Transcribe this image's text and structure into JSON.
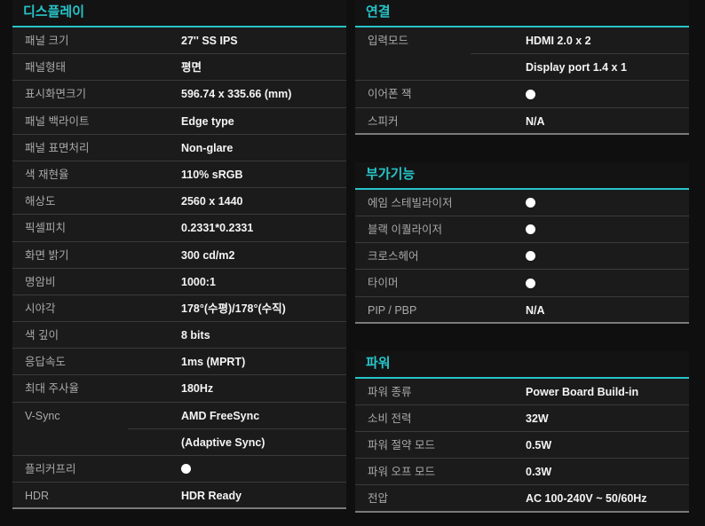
{
  "left": {
    "title": "디스플레이",
    "rows": [
      {
        "label": "패널 크기",
        "value": "27'' SS IPS"
      },
      {
        "label": "패널형태",
        "value": "평면"
      },
      {
        "label": "표시화면크기",
        "value": "596.74 x 335.66 (mm)"
      },
      {
        "label": "패널 백라이트",
        "value": "Edge type"
      },
      {
        "label": "패널 표면처리",
        "value": "Non-glare"
      },
      {
        "label": "색 재현율",
        "value": "110% sRGB"
      },
      {
        "label": "해상도",
        "value": "2560 x 1440"
      },
      {
        "label": "픽셀피치",
        "value": "0.2331*0.2331"
      },
      {
        "label": "화면 밝기",
        "value": "300 cd/m2"
      },
      {
        "label": "명암비",
        "value": "1000:1"
      },
      {
        "label": "시야각",
        "value": "178°(수평)/178°(수직)"
      },
      {
        "label": "색 깊이",
        "value": "8 bits"
      },
      {
        "label": "응답속도",
        "value": "1ms (MPRT)"
      },
      {
        "label": "최대 주사율",
        "value": "180Hz"
      },
      {
        "label": "V-Sync",
        "value": "AMD FreeSync"
      },
      {
        "label": "",
        "value": "(Adaptive Sync)"
      },
      {
        "label": "플리커프리",
        "value": "●"
      },
      {
        "label": "HDR",
        "value": "HDR Ready"
      }
    ]
  },
  "connect": {
    "title": "연결",
    "rows": [
      {
        "label": "입력모드",
        "value": "HDMI 2.0 x 2"
      },
      {
        "label": "",
        "value": "Display port 1.4 x 1"
      },
      {
        "label": "이어폰 잭",
        "value": "●"
      },
      {
        "label": "스피커",
        "value": "N/A"
      }
    ]
  },
  "extra": {
    "title": "부가기능",
    "rows": [
      {
        "label": "에임 스테빌라이저",
        "value": "●"
      },
      {
        "label": "블랙 이퀄라이저",
        "value": "●"
      },
      {
        "label": "크로스헤어",
        "value": "●"
      },
      {
        "label": "타이머",
        "value": "●"
      },
      {
        "label": "PIP / PBP",
        "value": "N/A"
      }
    ]
  },
  "power": {
    "title": "파워",
    "rows": [
      {
        "label": "파워 종류",
        "value": "Power Board Build-in"
      },
      {
        "label": "소비 전력",
        "value": "32W"
      },
      {
        "label": "파워 절약 모드",
        "value": "0.5W"
      },
      {
        "label": "파워 오프 모드",
        "value": "0.3W"
      },
      {
        "label": "전압",
        "value": "AC 100-240V ~ 50/60Hz"
      }
    ]
  },
  "colors": {
    "accent": "#27c4c9",
    "background": "#0f0f0f",
    "row_bg": "#1b1b1b"
  }
}
